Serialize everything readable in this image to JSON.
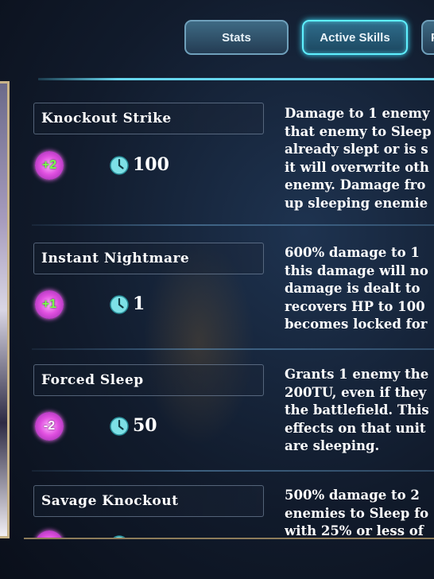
{
  "tabs": [
    {
      "label": "Stats",
      "active": false
    },
    {
      "label": "Active Skills",
      "active": true
    },
    {
      "label": "P",
      "active": false
    }
  ],
  "skills": [
    {
      "name": "Knockout Strike",
      "badge": "+2",
      "cost": "100",
      "description": [
        "Damage to 1 enemy",
        "that enemy to Sleep",
        "already slept or is s",
        "it will overwrite oth",
        "enemy. Damage fro",
        "up sleeping enemie"
      ]
    },
    {
      "name": "Instant Nightmare",
      "badge": "+1",
      "cost": "1",
      "description": [
        "600% damage to 1",
        "this damage will no",
        "damage is dealt to",
        "recovers HP to 100",
        "becomes locked for"
      ]
    },
    {
      "name": "Forced Sleep",
      "badge": "-2",
      "cost": "50",
      "description": [
        "Grants 1 enemy the",
        "200TU, even if they",
        "the battlefield. This",
        "effects on that unit",
        "are sleeping."
      ]
    },
    {
      "name": "Savage Knockout",
      "badge": "",
      "cost": "",
      "description": [
        "500% damage to 2",
        "enemies to Sleep fo",
        "with 25% or less of"
      ]
    }
  ],
  "colors": {
    "accent": "#5ff0ff",
    "badge": "#e04fe0",
    "badge_plus_text": "#7bff4a",
    "clock": "#7de0e6",
    "frame": "#c8b389"
  },
  "icons": {
    "clock": "clock-icon",
    "badge": "flower-badge-icon"
  }
}
